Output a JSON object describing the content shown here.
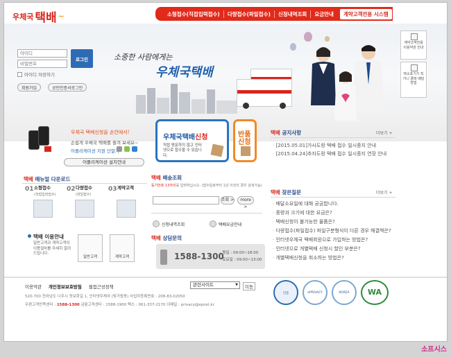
{
  "header": {
    "logo_small": "우체국",
    "logo_big": "택배",
    "nav": [
      "소형접수(직접입력접수)",
      "다량접수(파일접수)",
      "신청내역조회",
      "요금안내"
    ],
    "nav_highlight": "계약고객전용 시스템"
  },
  "login": {
    "id_placeholder": "아이디",
    "pw_placeholder": "비밀번호",
    "login_button": "로그인",
    "save_id": "아이디 저장하기",
    "join": "회원가입",
    "cert": "공인인증서로그인"
  },
  "hero": {
    "slogan": "소중한 사람에게는",
    "brand": "우체국택배"
  },
  "side_cards": [
    {
      "label": "계약고객전용 이용약관 안내"
    },
    {
      "label": "택소포기기 직거니 클래 배달방법"
    }
  ],
  "app_promo": {
    "line1": "우체국 택배신청을 손안에서!",
    "line2": "손쉽게 우체국 택배를 즐겨 보세요~",
    "line3": "어플리케이션 지원 단말기",
    "install": "어플리케이션 설치안내"
  },
  "apply": {
    "title_blue": "우체국택배",
    "title_red": "신청",
    "desc": "직접 방문하지 않고 인터넷으로 접수할 수 있습니다."
  },
  "return_box": {
    "title": "반품 신청"
  },
  "notice": {
    "title_prefix": "택배",
    "title": "공지사항",
    "more": "더보기 +",
    "items": [
      "[2015.05.01]가사도랑 택배 접수 일시중지 안내",
      "[2015.04.24]추자도랑 택배 접수 일시중지 연장 안내"
    ]
  },
  "faq": {
    "title_prefix": "택배",
    "title": "잦은질문",
    "more": "더보기 +",
    "items": [
      "배달소요일에 대해 궁금합니다.",
      "중량과 크기에 대한 요금은?",
      "택배신청이 불가능한 물품은?",
      "다량접수(파일접수) 파일구분형식이 다른 경우 해결책은?",
      "인터넷우체국 택배회원으로 가입하는 방법은?",
      "인터넷으로 개별택배 신청시 할인 부분은?",
      "개별택배신청을 취소하는 방법은?"
    ]
  },
  "manual": {
    "title_prefix": "택배",
    "title": "매뉴얼 다운로드",
    "steps": [
      {
        "num": "01",
        "label": "소형접수",
        "sub": "(직접입력접수)"
      },
      {
        "num": "02",
        "label": "다량접수",
        "sub": "(파일접수)"
      },
      {
        "num": "03",
        "label": "계약고객",
        "sub": ""
      }
    ]
  },
  "tracking": {
    "title_prefix": "택배",
    "title": "배송조회",
    "desc_red": "등기번호 13자리",
    "desc": "를 입력하십시오. (접수일로부터 1년 이전의 경우 검색가능)",
    "search": "조회 >",
    "more": "more >",
    "link1": "신청내역조회",
    "link2": "택배요금안내"
  },
  "guide": {
    "title": "택배 이용안내",
    "desc": "일반고객과 계약고객의 이용절차를 자세히 알려 드립니다.",
    "btn1": "일반고객",
    "btn2": "계약고객"
  },
  "cs": {
    "title_prefix": "택배",
    "title": "상담문의",
    "phone": "1588-1300",
    "weekday": "· 평일 : 09:00~18:00",
    "saturday": "· 토요일 : 09:00~13:00"
  },
  "footer": {
    "links": [
      "이용약관",
      "개인정보보호방침",
      "웹접근성정책"
    ],
    "related": "관련사이트",
    "go": "이동",
    "address_line1": "520-700 전라남도 나주시 정보화길 1, 인터넷우체국 (빛가람동)     사업자등록번호 : 208-83-02050",
    "address_line2_a": "우편고객만족센터 : ",
    "address_line2_phone": "1588-1300",
    "address_line2_b": "     금융고객센터 : 1588-1900     팩스 : 061-337-2170     이메일 : privacy@epost.kr",
    "badges": [
      "인증",
      "ePRIVACY",
      "KOREA",
      "WA"
    ]
  },
  "watermark": "소프시스"
}
